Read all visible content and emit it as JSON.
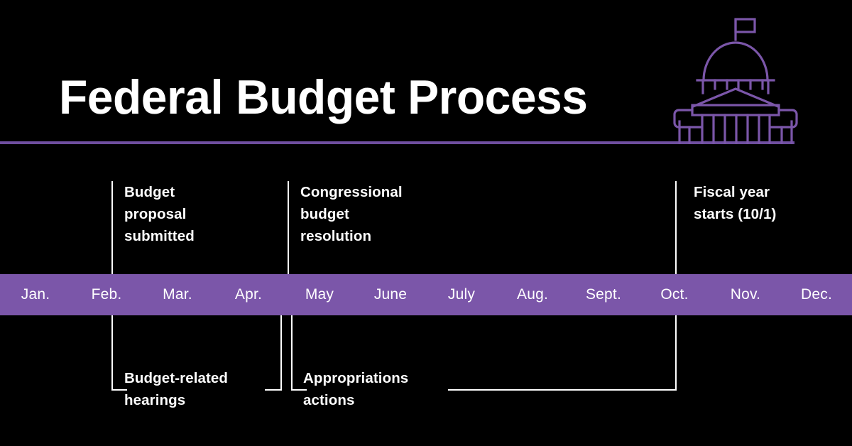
{
  "header": {
    "title": "Federal Budget Process",
    "icon": "capitol-building-icon",
    "rule_color": "#6f4fa0"
  },
  "theme": {
    "background": "#000000",
    "accent_purple": "#7b56a9",
    "rule_purple": "#6f4fa0",
    "text": "#ffffff"
  },
  "timeline": {
    "bar_color": "#7b56a9",
    "months": [
      {
        "label": "Jan."
      },
      {
        "label": "Feb."
      },
      {
        "label": "Mar."
      },
      {
        "label": "Apr."
      },
      {
        "label": "May"
      },
      {
        "label": "June"
      },
      {
        "label": "July"
      },
      {
        "label": "Aug."
      },
      {
        "label": "Sept."
      },
      {
        "label": "Oct."
      },
      {
        "label": "Nov."
      },
      {
        "label": "Dec."
      }
    ]
  },
  "callouts": {
    "above": [
      {
        "id": "budget-proposal-submitted",
        "line1": "Budget",
        "line2": "proposal",
        "line3": "submitted"
      },
      {
        "id": "congressional-budget-resolution",
        "line1": "Congressional",
        "line2": "budget",
        "line3": "resolution"
      },
      {
        "id": "fiscal-year-starts",
        "line1": "Fiscal year",
        "line2": "starts (10/1)",
        "line3": ""
      }
    ],
    "below": [
      {
        "id": "budget-related-hearings",
        "line1": "Budget-related",
        "line2": "hearings"
      },
      {
        "id": "appropriations-actions",
        "line1": "Appropriations",
        "line2": "actions"
      }
    ]
  }
}
